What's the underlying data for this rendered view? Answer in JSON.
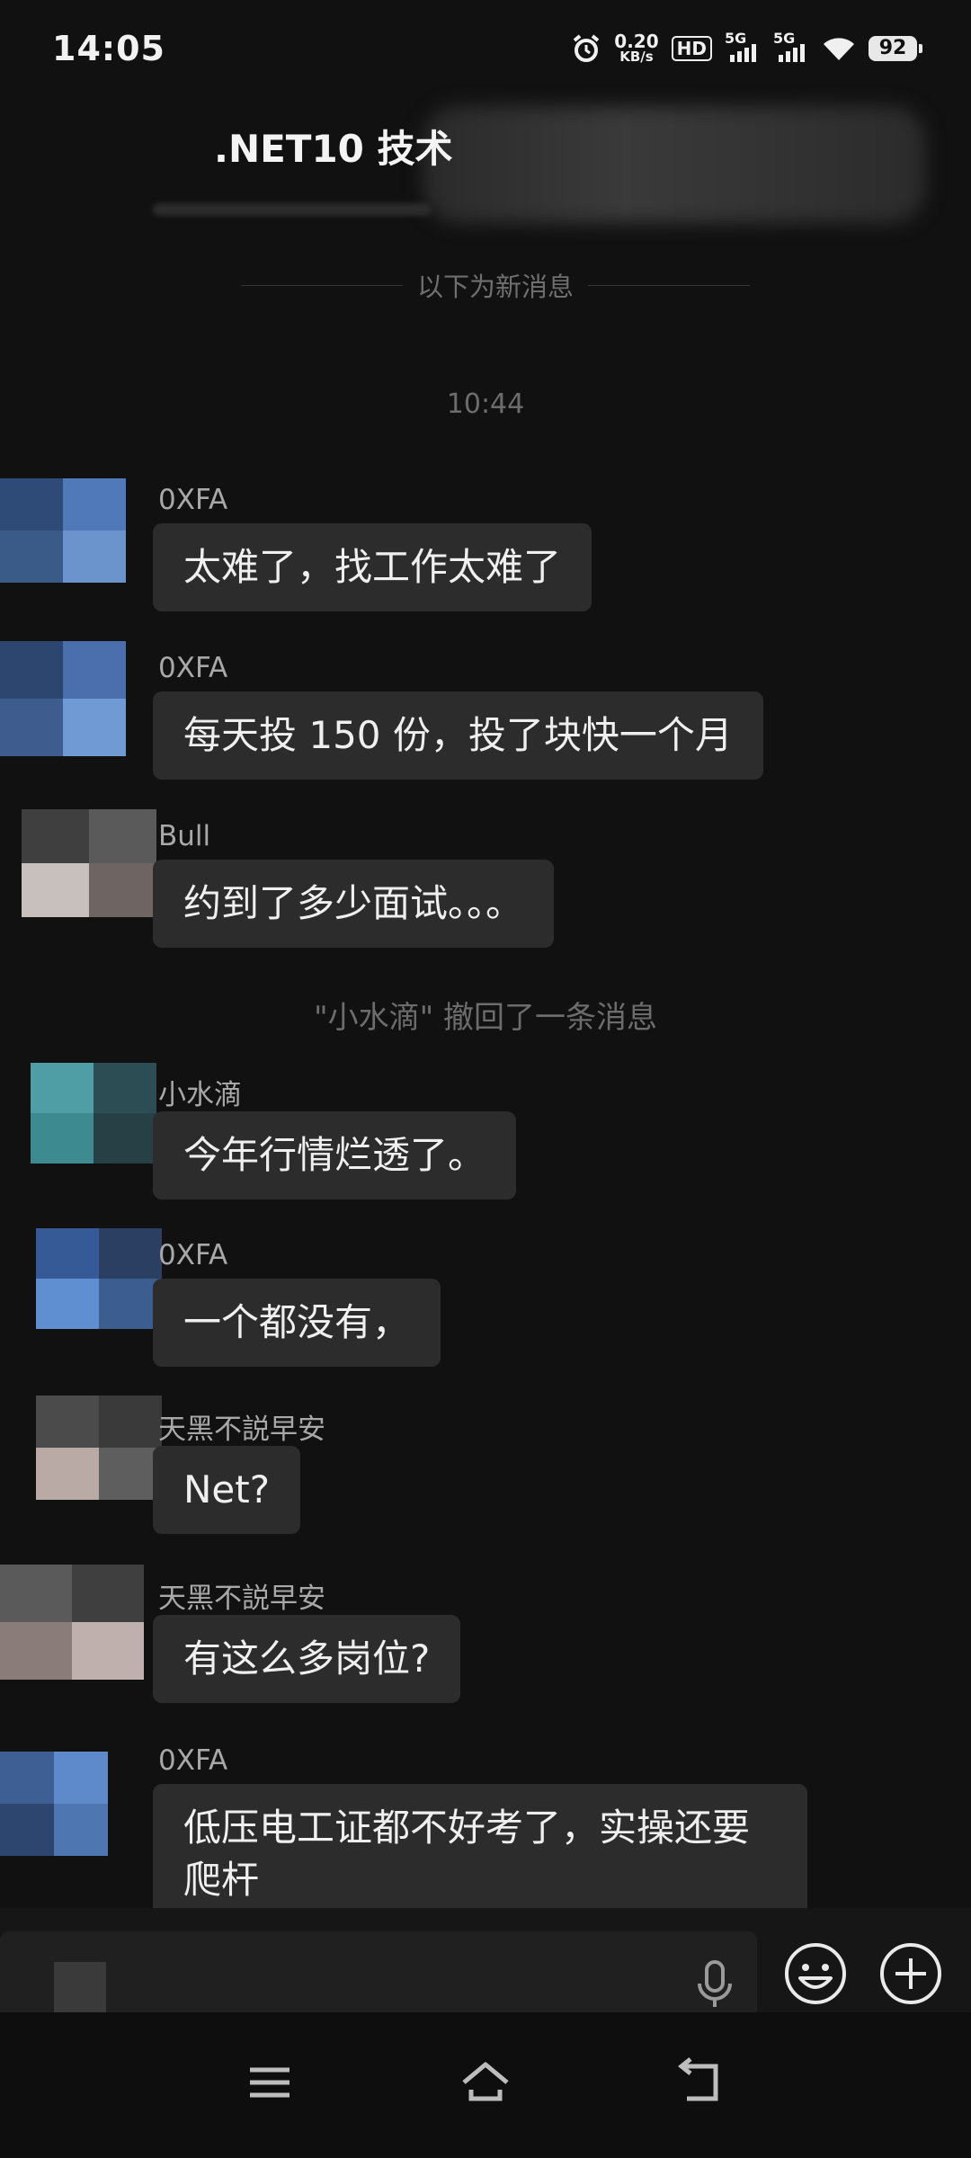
{
  "status_bar": {
    "time": "14:05",
    "net_speed_value": "0.20",
    "net_speed_unit": "KB/s",
    "hd_label": "HD",
    "signal1_label": "5G",
    "signal2_label": "5G",
    "battery": "92"
  },
  "chat": {
    "title": ".NET10 技术",
    "new_messages_divider": "以下为新消息",
    "timestamp": "10:44",
    "recall_notice": "\"小水滴\" 撤回了一条消息"
  },
  "messages": [
    {
      "sender": "0XFA",
      "text": "太难了，找工作太难了"
    },
    {
      "sender": "0XFA",
      "text": "每天投 150 份，投了块快一个月"
    },
    {
      "sender": "Bull",
      "text": "约到了多少面试。。。"
    },
    {
      "sender": "小水滴",
      "text": "今年行情烂透了。"
    },
    {
      "sender": "0XFA",
      "text": "一个都没有，"
    },
    {
      "sender": "天黑不説早安",
      "text": "Net?"
    },
    {
      "sender": "天黑不説早安",
      "text": "有这么多岗位?"
    },
    {
      "sender": "0XFA",
      "text": "低压电工证都不好考了，实操还要爬杆"
    }
  ],
  "input_bar": {
    "icons": [
      "microphone-icon",
      "emoji-icon",
      "plus-icon"
    ]
  },
  "navigation": {
    "icons": [
      "menu-icon",
      "home-icon",
      "back-icon"
    ]
  },
  "colors": {
    "background": "#111111",
    "bubble": "#2c2c2c",
    "text": "#efefef",
    "sender": "#a8a8a8",
    "muted": "#6c6c6c"
  }
}
